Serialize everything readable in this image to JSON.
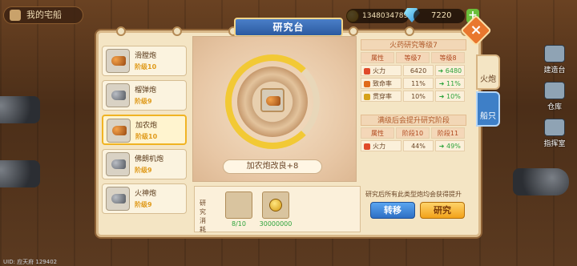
{
  "topbar": {
    "home_label": "我的宅船",
    "coins": "13480347897",
    "gems": "7220",
    "plus": "+"
  },
  "title": "研究台",
  "list": [
    {
      "name": "滑膛炮",
      "level": "阶级10",
      "grey": false
    },
    {
      "name": "榴弹炮",
      "level": "阶级9",
      "grey": true
    },
    {
      "name": "加农炮",
      "level": "阶级10",
      "grey": false,
      "selected": true
    },
    {
      "name": "佛朗机炮",
      "level": "阶级9",
      "grey": true
    },
    {
      "name": "火神炮",
      "level": "阶级9",
      "grey": true
    },
    {
      "name": "",
      "level": "",
      "grey": false
    }
  ],
  "center": {
    "caption": "加农炮改良+8"
  },
  "stats": {
    "header": "火药研究等级7",
    "cols": [
      "属性",
      "等级7",
      "等级8"
    ],
    "rows": [
      {
        "name": "火力",
        "a": "6420",
        "b": "6480",
        "color": "#e04a2a"
      },
      {
        "name": "致命率",
        "a": "11%",
        "b": "11%",
        "color": "#e06a1a"
      },
      {
        "name": "贯穿率",
        "a": "10%",
        "b": "10%",
        "color": "#d6a21a"
      }
    ],
    "header2": "满级后会提升研究阶段",
    "cols2": [
      "属性",
      "阶段10",
      "阶段11"
    ],
    "rows2": [
      {
        "name": "火力",
        "a": "44%",
        "b": "49%",
        "color": "#e04a2a"
      }
    ]
  },
  "cost": {
    "label": "研究消耗",
    "item_count": "8/10",
    "coin_count": "30000000"
  },
  "note": "研究后所有此类型炮均会获得提升",
  "buttons": {
    "transfer": "转移",
    "research": "研究"
  },
  "tabs": {
    "cannon": "火炮",
    "ship": "船只"
  },
  "side": {
    "build": "建造台",
    "warehouse": "仓库",
    "command": "指挥室"
  },
  "status": "UID: 应天府 129402"
}
